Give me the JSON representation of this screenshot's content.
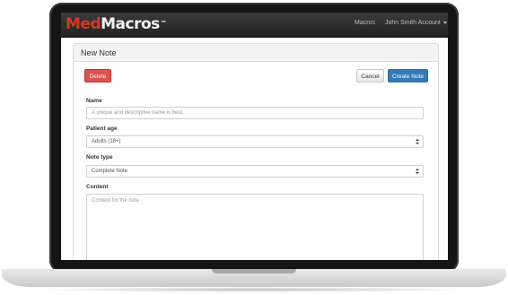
{
  "navbar": {
    "brand_part1": "Med",
    "brand_part2": "Macros",
    "brand_tm": "™",
    "link_macros": "Macros",
    "account_label": "John Smith Account"
  },
  "panel": {
    "title": "New Note"
  },
  "buttons": {
    "delete": "Delete",
    "cancel": "Cancel",
    "create": "Create Note"
  },
  "form": {
    "name_label": "Name",
    "name_placeholder": "A unique and descriptive name is best.",
    "age_label": "Patient age",
    "age_value": "Adults (18+)",
    "type_label": "Note type",
    "type_value": "Complete Note",
    "content_label": "Content",
    "content_placeholder": "Content for the note"
  },
  "colors": {
    "brand_red": "#d43b1f",
    "delete_red": "#d9534f",
    "primary_blue": "#337ab7",
    "navbar_dark": "#2b2b2b"
  }
}
